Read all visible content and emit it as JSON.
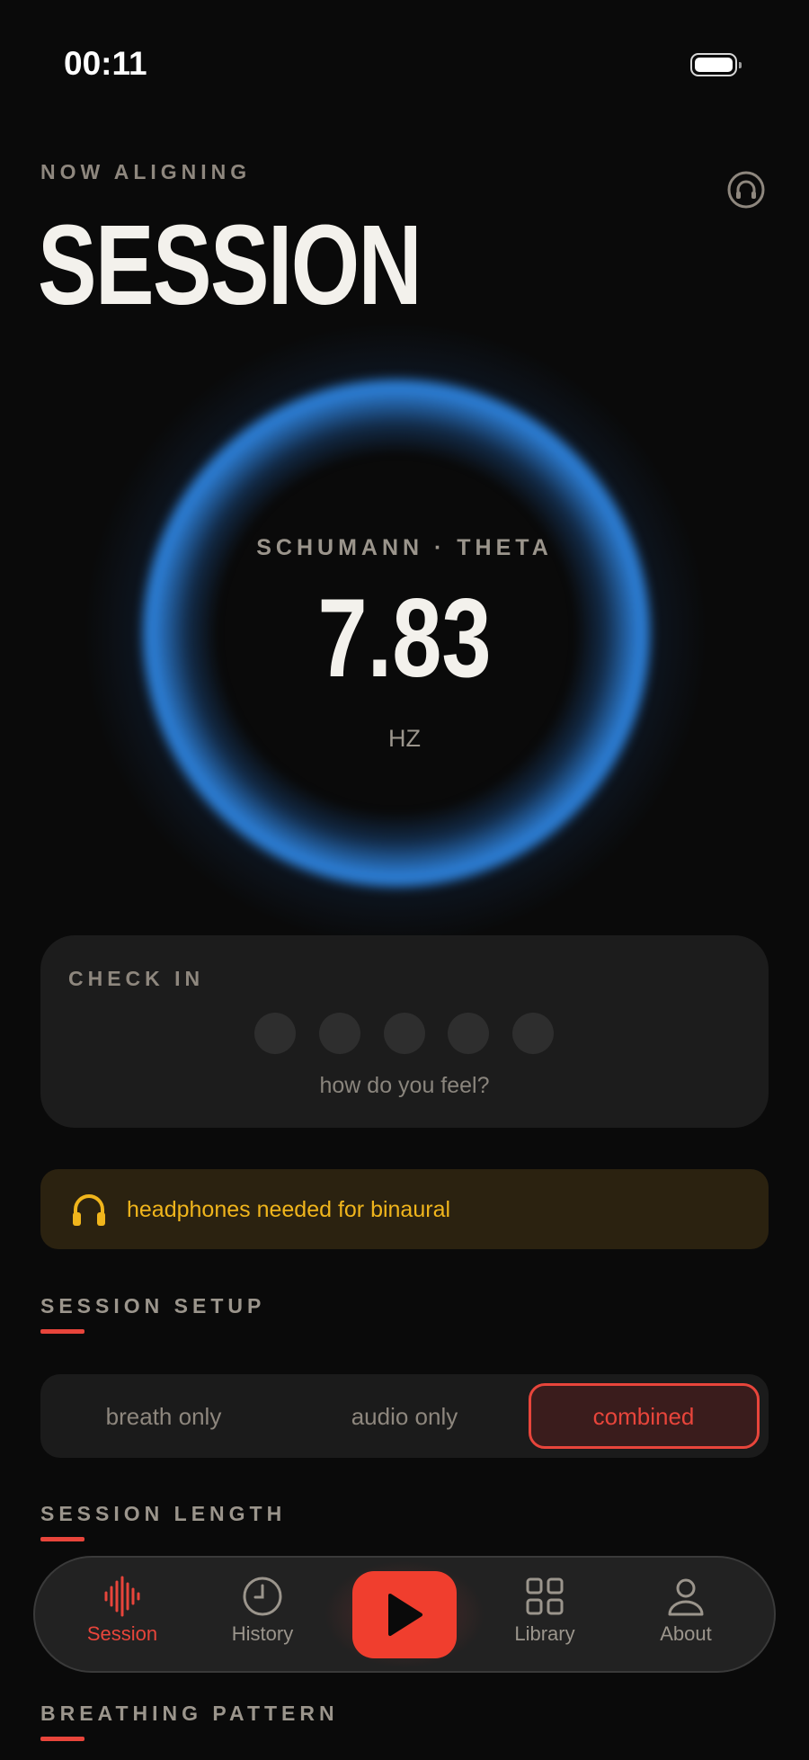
{
  "status": {
    "time": "00:11"
  },
  "header": {
    "eyebrow": "NOW ALIGNING",
    "title": "SESSION"
  },
  "ring": {
    "label": "SCHUMANN · THETA",
    "value": "7.83",
    "unit": "HZ"
  },
  "checkin": {
    "title": "CHECK IN",
    "subtitle": "how do you feel?",
    "options_count": 5
  },
  "warning": {
    "text": "headphones needed for binaural",
    "color": "#f0b51c"
  },
  "setup": {
    "title": "SESSION SETUP",
    "options": [
      "breath only",
      "audio only",
      "combined"
    ],
    "selected": "combined"
  },
  "length": {
    "title": "SESSION LENGTH"
  },
  "breathing": {
    "title": "BREATHING PATTERN"
  },
  "nav": {
    "items": [
      "Session",
      "History",
      "Library",
      "About"
    ],
    "active": "Session"
  },
  "colors": {
    "accent": "#e8453b",
    "ring": "#2d7fd6",
    "background": "#0a0a0a"
  }
}
